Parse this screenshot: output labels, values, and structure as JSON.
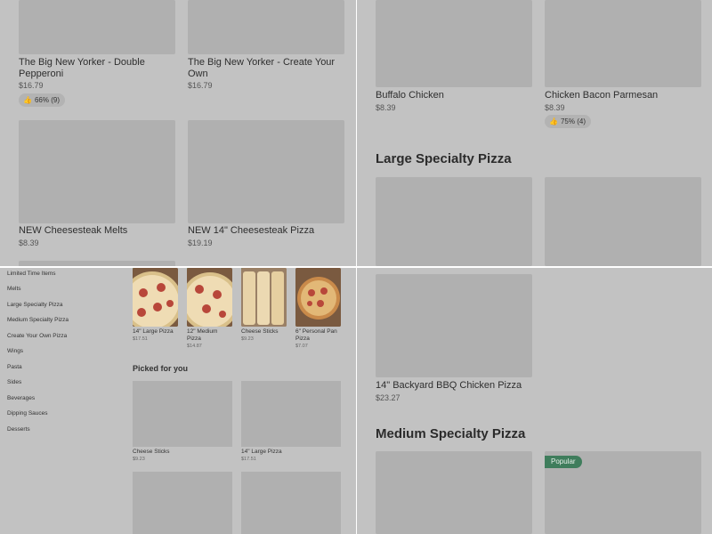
{
  "q1": {
    "items": [
      {
        "name": "The Big New Yorker - Double Pepperoni",
        "price": "$16.79",
        "rating": "66% (9)"
      },
      {
        "name": "The Big New Yorker - Create Your Own",
        "price": "$16.79"
      },
      {
        "name": "NEW Cheesesteak Melts",
        "price": "$8.39"
      },
      {
        "name": "NEW 14\" Cheesesteak Pizza",
        "price": "$19.19"
      }
    ]
  },
  "q2": {
    "items": [
      {
        "name": "Buffalo Chicken",
        "price": "$8.39"
      },
      {
        "name": "Chicken Bacon Parmesan",
        "price": "$8.39",
        "rating": "75% (4)"
      }
    ],
    "section_title": "Large Specialty Pizza"
  },
  "q3": {
    "sidebar": [
      "Limited Time Items",
      "Melts",
      "Large Specialty Pizza",
      "Medium Specialty Pizza",
      "Create Your Own Pizza",
      "Wings",
      "Pasta",
      "Sides",
      "Beverages",
      "Dipping Sauces",
      "Desserts"
    ],
    "featured": [
      {
        "name": "14\" Large Pizza",
        "price": "$17.51"
      },
      {
        "name": "12\" Medium Pizza",
        "price": "$14.87"
      },
      {
        "name": "Cheese Sticks",
        "price": "$9.23"
      },
      {
        "name": "6\" Personal Pan Pizza",
        "price": "$7.07"
      }
    ],
    "picked_title": "Picked for you",
    "picked": [
      {
        "name": "Cheese Sticks",
        "price": "$9.23"
      },
      {
        "name": "14\" Large Pizza",
        "price": "$17.51"
      }
    ]
  },
  "q4": {
    "item": {
      "name": "14\" Backyard BBQ Chicken Pizza",
      "price": "$23.27"
    },
    "section_title": "Medium Specialty Pizza",
    "popular_label": "Popular"
  },
  "icons": {
    "rating": "thumbs-up-icon"
  },
  "colors": {
    "background": "#c2c2c2",
    "placeholder": "#b0b0b0",
    "popular": "#3f7d5c"
  }
}
